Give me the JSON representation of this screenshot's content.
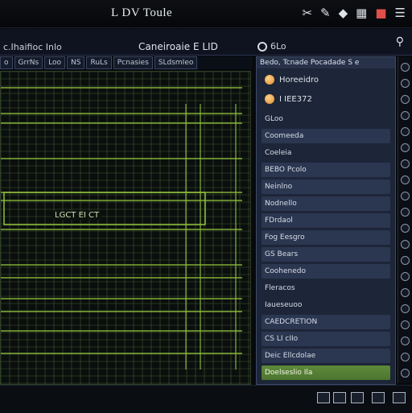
{
  "window": {
    "title": "L DV Toule"
  },
  "title_icons": [
    "tool-icon",
    "pen-icon",
    "drop-icon",
    "grid-icon",
    "bug-icon",
    "menu-icon"
  ],
  "header": {
    "left_label": "c.Ihaifioc Inlo",
    "center_label": "Caneiroaie  E LID",
    "right_label": "6Lo",
    "search_icon": "search-icon"
  },
  "tabs": [
    "o",
    "GrrNs",
    "Loo",
    "NS",
    "RuLs",
    "Pcnasies",
    "SLdsmIeo"
  ],
  "grid": {
    "label": "LGCT  EI   CT",
    "accent": "#8fbf3a"
  },
  "side_panel": {
    "header": "Bedo, Tcnade Pocadade S e",
    "options": [
      {
        "label": "Horeeidro",
        "selected": true
      },
      {
        "label": "I IEE372",
        "selected": true
      }
    ],
    "items": [
      {
        "label": "GLoo",
        "style": "plain"
      },
      {
        "label": "Coomeeda",
        "style": "box"
      },
      {
        "label": "Coeleia",
        "style": "plain"
      },
      {
        "label": "BEBO  Pcolo",
        "style": "box"
      },
      {
        "label": "Neinlno",
        "style": "box"
      },
      {
        "label": "Nodnello",
        "style": "box"
      },
      {
        "label": "FDrdaol",
        "style": "box"
      },
      {
        "label": "Fog Eesgro",
        "style": "box"
      },
      {
        "label": "GS Bears",
        "style": "box"
      },
      {
        "label": "Coohenedo",
        "style": "box"
      },
      {
        "label": "Fleracos",
        "style": "plain"
      },
      {
        "label": "Iaueseuoo",
        "style": "plain"
      },
      {
        "label": "CAEDCRETION",
        "style": "box"
      },
      {
        "label": "CS LI cIIo",
        "style": "box"
      },
      {
        "label": "Deic Ellcdolae",
        "style": "box"
      },
      {
        "label": "Doelseslio    Ila",
        "style": "active"
      }
    ]
  }
}
